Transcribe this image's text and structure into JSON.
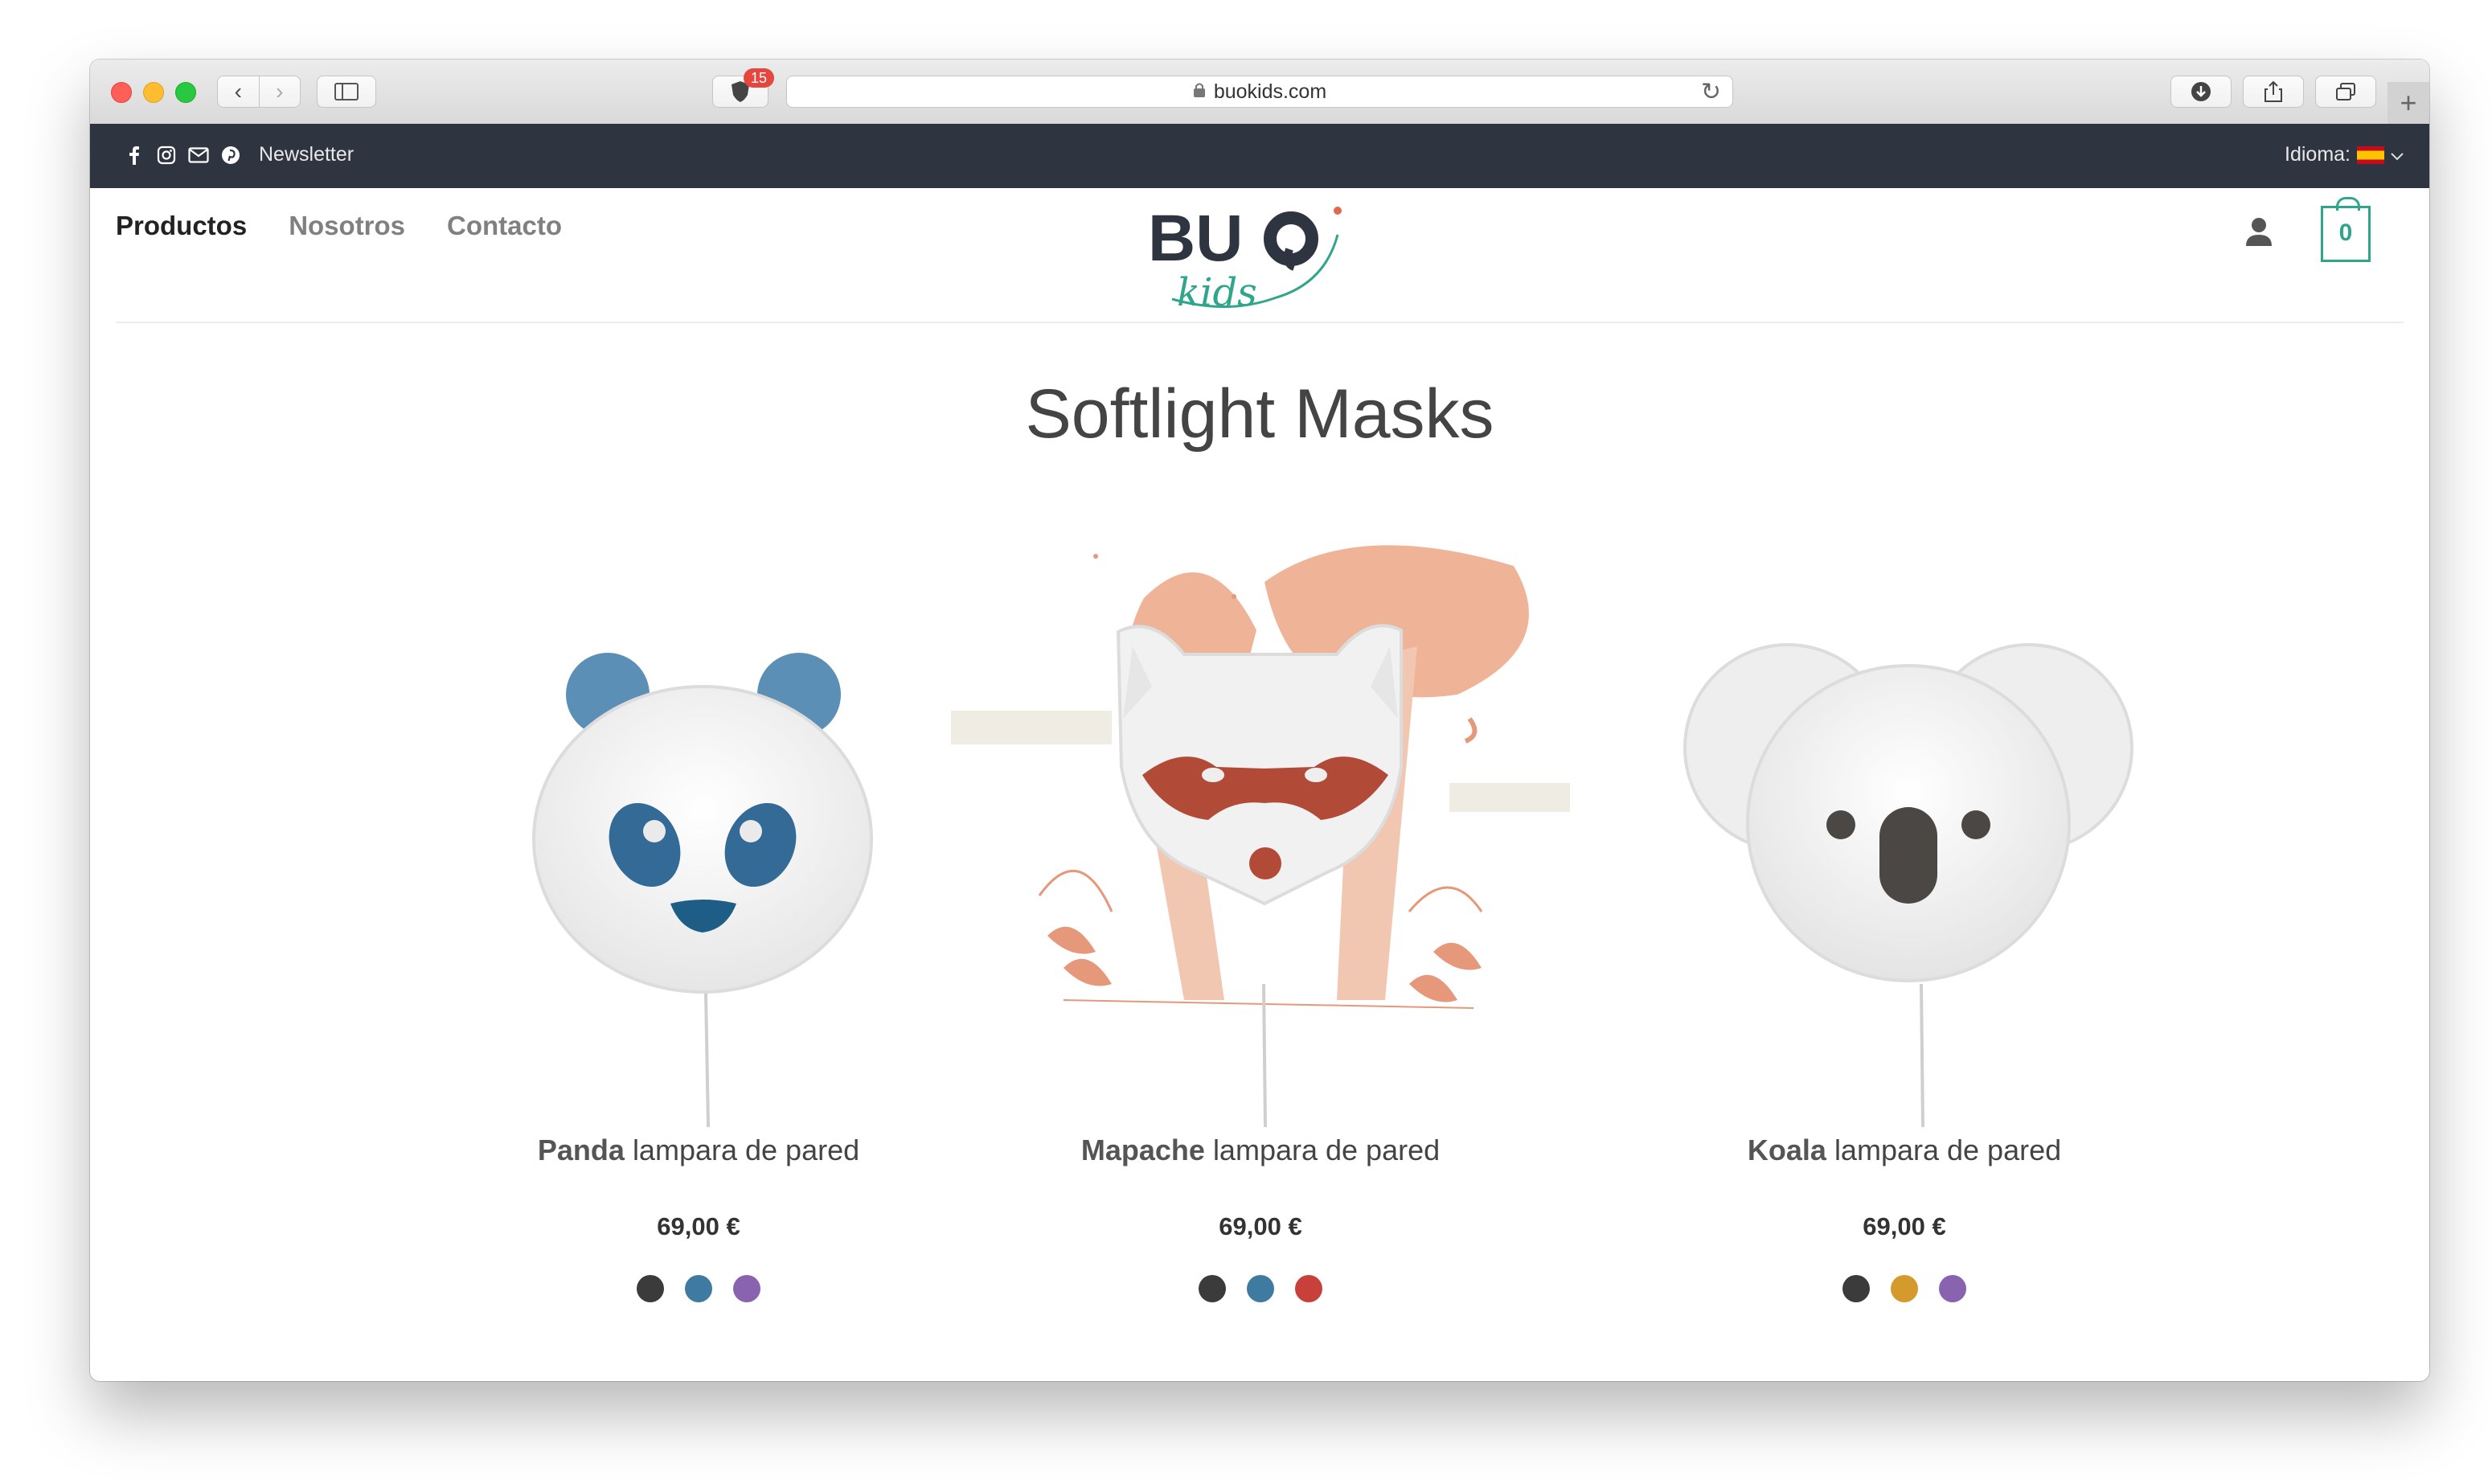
{
  "browser": {
    "url": "buokids.com",
    "shield_badge": "15"
  },
  "topbar": {
    "newsletter": "Newsletter",
    "language_label": "Idioma:"
  },
  "nav": {
    "items": [
      "Productos",
      "Nosotros",
      "Contacto"
    ]
  },
  "brand": {
    "logo_text_main": "BUO",
    "logo_text_sub": "kids"
  },
  "cart": {
    "count": "0"
  },
  "page": {
    "title": "Softlight Masks"
  },
  "products": [
    {
      "name": "Panda",
      "desc": "lampara de pared",
      "price": "69,00 €",
      "colors": [
        "#3b3b3b",
        "#3f7aa0",
        "#8a63b0"
      ]
    },
    {
      "name": "Mapache",
      "desc": "lampara de pared",
      "price": "69,00 €",
      "colors": [
        "#3b3b3b",
        "#3f7aa0",
        "#c8403a"
      ]
    },
    {
      "name": "Koala",
      "desc": "lampara de pared",
      "price": "69,00 €",
      "colors": [
        "#3b3b3b",
        "#d49a2c",
        "#8a63b0"
      ]
    }
  ]
}
